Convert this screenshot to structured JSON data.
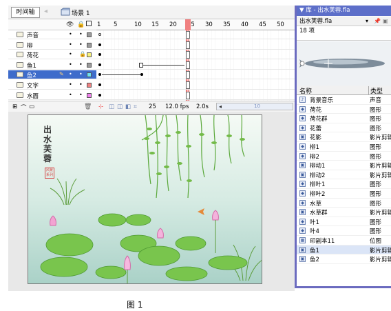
{
  "toolbar": {
    "timeline_tab": "时间轴",
    "scene_label": "场景 1"
  },
  "timeline": {
    "frame_ticks": [
      "1",
      "5",
      "10",
      "15",
      "20",
      "25",
      "30",
      "35",
      "40",
      "45",
      "50"
    ],
    "layers": [
      {
        "name": "声音",
        "color": "#9a9a9a",
        "selected": false,
        "has_lock": false
      },
      {
        "name": "柳",
        "color": "#9a9a9a",
        "selected": false,
        "has_lock": false
      },
      {
        "name": "荷花",
        "color": "#f6f07a",
        "selected": false,
        "has_lock": true
      },
      {
        "name": "鱼1",
        "color": "#9a9a9a",
        "selected": false,
        "has_lock": false
      },
      {
        "name": "鱼2",
        "color": "#6ee1f1",
        "selected": true,
        "has_lock": false
      },
      {
        "name": "文字",
        "color": "#ef8282",
        "selected": false,
        "has_lock": false
      },
      {
        "name": "水面",
        "color": "#ef80ec",
        "selected": false,
        "has_lock": false
      }
    ],
    "footer": {
      "current_frame": "25",
      "frame_rate": "12.0 fps",
      "elapsed": "2.0s",
      "scroll_mark": "10"
    }
  },
  "stage": {
    "title": "出水芙蓉",
    "seal_text": "风景 系列"
  },
  "library": {
    "title": "库 - 出水芙蓉.fla",
    "file": "出水芙蓉.fla",
    "count": "18 项",
    "col_name": "名称",
    "col_type": "类型",
    "items": [
      {
        "icon": "sound-icon",
        "name": "背景音乐",
        "type": "声音"
      },
      {
        "icon": "graphic-icon",
        "name": "荷花",
        "type": "图形"
      },
      {
        "icon": "graphic-icon",
        "name": "荷花群",
        "type": "图形"
      },
      {
        "icon": "graphic-icon",
        "name": "花蕾",
        "type": "图形"
      },
      {
        "icon": "movieclip-icon",
        "name": "花影",
        "type": "影片剪辑"
      },
      {
        "icon": "graphic-icon",
        "name": "柳1",
        "type": "图形"
      },
      {
        "icon": "graphic-icon",
        "name": "柳2",
        "type": "图形"
      },
      {
        "icon": "movieclip-icon",
        "name": "柳动1",
        "type": "影片剪辑"
      },
      {
        "icon": "movieclip-icon",
        "name": "柳动2",
        "type": "影片剪辑"
      },
      {
        "icon": "graphic-icon",
        "name": "柳叶1",
        "type": "图形"
      },
      {
        "icon": "graphic-icon",
        "name": "柳叶2",
        "type": "图形"
      },
      {
        "icon": "graphic-icon",
        "name": "水草",
        "type": "图形"
      },
      {
        "icon": "movieclip-icon",
        "name": "水草群",
        "type": "影片剪辑"
      },
      {
        "icon": "graphic-icon",
        "name": "叶1",
        "type": "图形"
      },
      {
        "icon": "graphic-icon",
        "name": "叶4",
        "type": "图形"
      },
      {
        "icon": "bitmap-icon",
        "name": "印副本11",
        "type": "位图"
      },
      {
        "icon": "movieclip-icon",
        "name": "鱼1",
        "type": "影片剪辑"
      },
      {
        "icon": "movieclip-icon",
        "name": "鱼2",
        "type": "影片剪辑"
      }
    ]
  },
  "caption": "图 1"
}
